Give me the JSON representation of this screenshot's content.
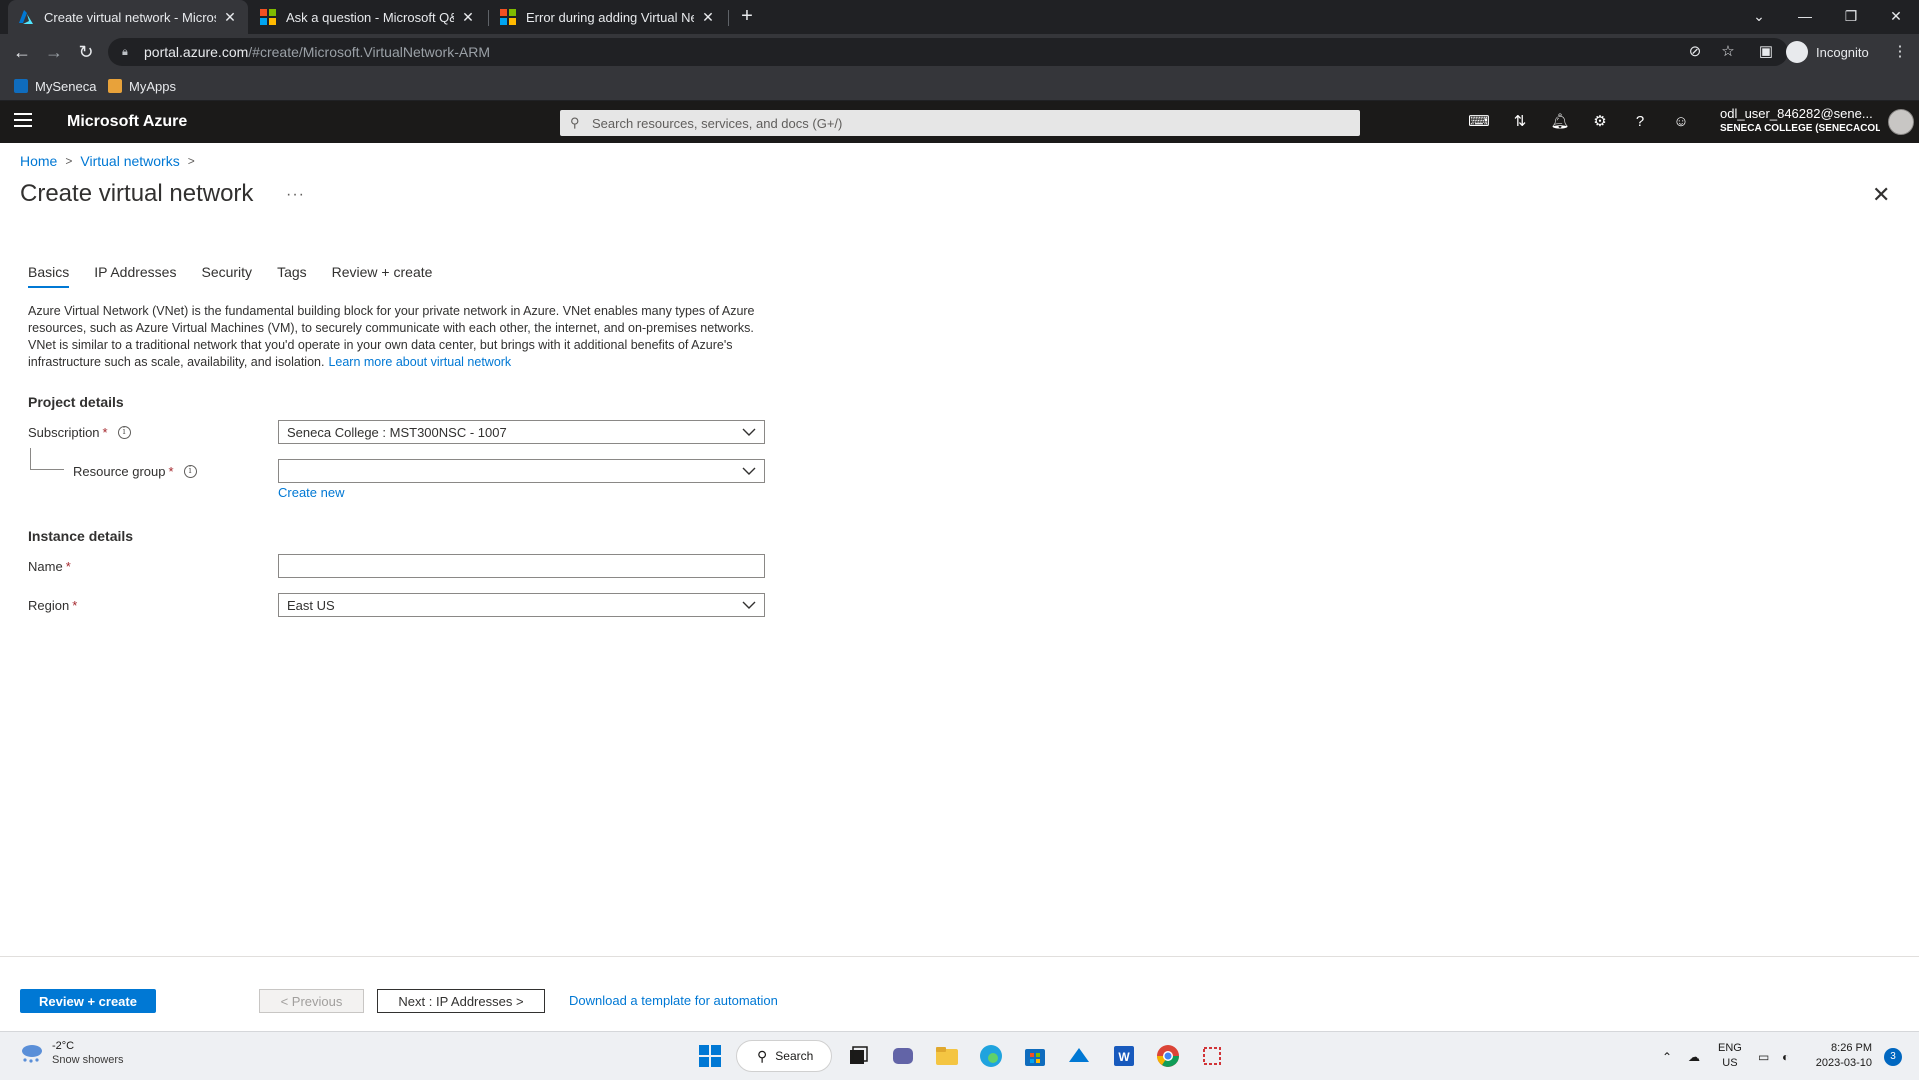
{
  "browser": {
    "tabs": [
      {
        "title": "Create virtual network - Microsof",
        "active": true
      },
      {
        "title": "Ask a question - Microsoft Q&A",
        "active": false
      },
      {
        "title": "Error during adding Virtual Netw",
        "active": false
      }
    ],
    "url_host": "portal.azure.com",
    "url_path": "/#create/Microsoft.VirtualNetwork-ARM",
    "profile_label": "Incognito",
    "bookmarks": [
      "MySeneca",
      "MyApps"
    ]
  },
  "azure": {
    "brand": "Microsoft Azure",
    "search_placeholder": "Search resources, services, and docs (G+/)",
    "account_user": "odl_user_846282@sene...",
    "account_org": "SENECA COLLEGE (SENECACOLLE..."
  },
  "page": {
    "breadcrumb": [
      "Home",
      "Virtual networks"
    ],
    "title": "Create virtual network",
    "tabs": [
      "Basics",
      "IP Addresses",
      "Security",
      "Tags",
      "Review + create"
    ],
    "description": "Azure Virtual Network (VNet) is the fundamental building block for your private network in Azure. VNet enables many types of Azure resources, such as Azure Virtual Machines (VM), to securely communicate with each other, the internet, and on-premises networks. VNet is similar to a traditional network that you'd operate in your own data center, but brings with it additional benefits of Azure's infrastructure such as scale, availability, and isolation.",
    "learn_more": "Learn more about virtual network",
    "project_details": "Project details",
    "subscription_label": "Subscription",
    "subscription_value": "Seneca College : MST300NSC - 1007",
    "resource_group_label": "Resource group",
    "resource_group_value": "",
    "create_new": "Create new",
    "instance_details": "Instance details",
    "name_label": "Name",
    "name_value": "",
    "region_label": "Region",
    "region_value": "East US",
    "required_mark": "*"
  },
  "footer": {
    "review_create": "Review + create",
    "previous": "< Previous",
    "next": "Next : IP Addresses >",
    "download_template": "Download a template for automation"
  },
  "taskbar": {
    "temperature": "-2°C",
    "weather": "Snow showers",
    "search": "Search",
    "lang_1": "ENG",
    "lang_2": "US",
    "time": "8:26 PM",
    "date": "2023-03-10",
    "notifications": "3"
  },
  "colors": {
    "accent": "#0078d4",
    "header_bg": "#1b1a19",
    "required": "#a4262c"
  }
}
